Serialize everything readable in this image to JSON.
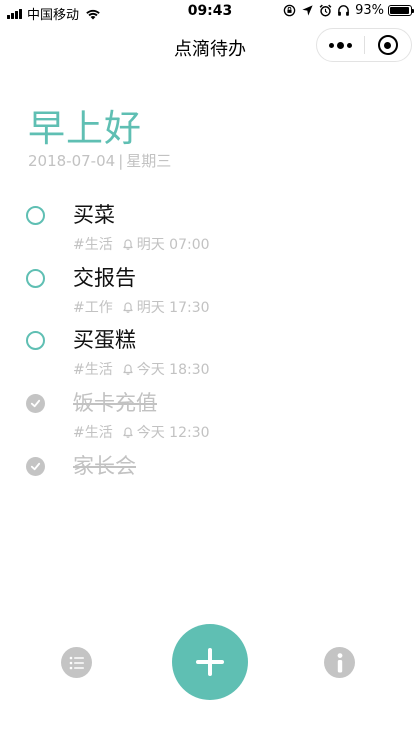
{
  "status_bar": {
    "carrier": "中国移动",
    "time": "09:43",
    "battery_percent": "93%",
    "battery_level": 0.93,
    "icons": [
      "signal-icon",
      "wifi-icon",
      "rotation-lock-icon",
      "location-icon",
      "alarm-icon",
      "headphones-icon",
      "battery-icon"
    ]
  },
  "nav": {
    "title": "点滴待办",
    "capsule_icons": [
      "more-icon",
      "close-mini-program-icon"
    ]
  },
  "greeting": {
    "text": "早上好",
    "date": "2018-07-04",
    "separator": "|",
    "weekday": "星期三"
  },
  "tasks": [
    {
      "title": "买菜",
      "tag": "#生活",
      "reminder": "明天 07:00",
      "done": false
    },
    {
      "title": "交报告",
      "tag": "#工作",
      "reminder": "明天 17:30",
      "done": false
    },
    {
      "title": "买蛋糕",
      "tag": "#生活",
      "reminder": "今天 18:30",
      "done": false
    },
    {
      "title": "饭卡充值",
      "tag": "#生活",
      "reminder": "今天 12:30",
      "done": true
    },
    {
      "title": "家长会",
      "done": true
    }
  ],
  "bottom_bar": {
    "icons": [
      "list-icon",
      "plus-icon",
      "info-icon"
    ]
  },
  "colors": {
    "accent": "#5fbfb3",
    "muted": "#c2c2c2",
    "done_check": "#c4c4c4"
  }
}
